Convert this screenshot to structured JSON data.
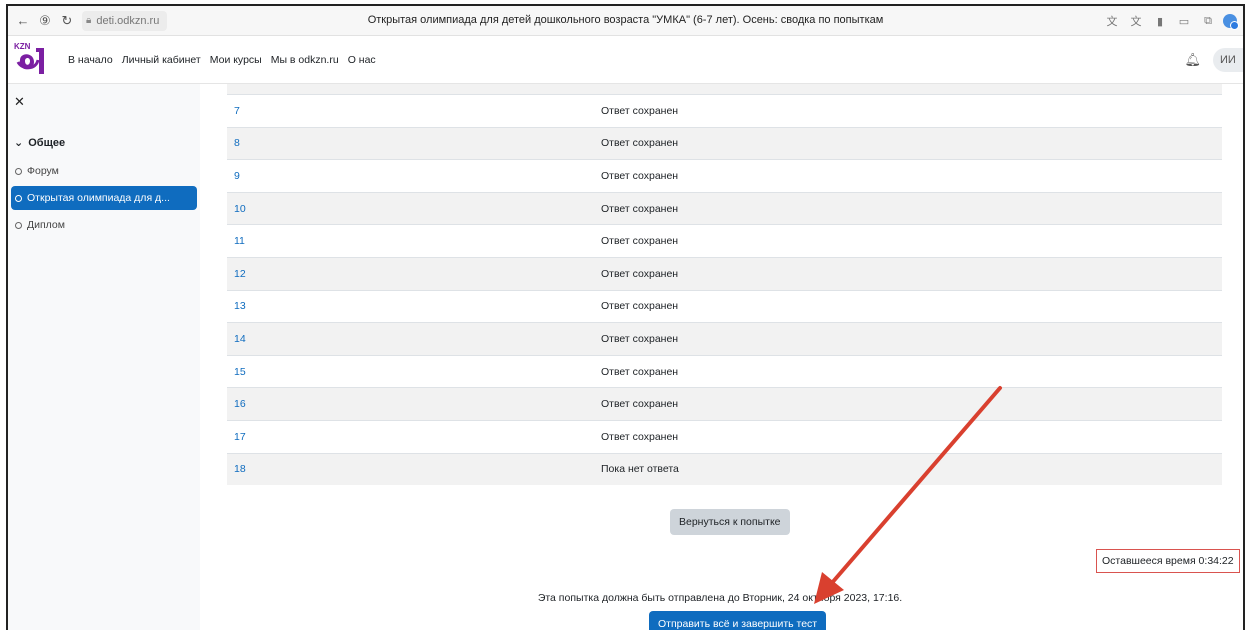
{
  "browser": {
    "url": "deti.odkzn.ru",
    "tab_title": "Открытая олимпиада для детей дошкольного возраста \"УМКА\" (6-7 лет). Осень: сводка по попыткам"
  },
  "nav": {
    "logo_text": "KZN",
    "links": [
      "В начало",
      "Личный кабинет",
      "Мои курсы",
      "Мы в odkzn.ru",
      "О нас"
    ],
    "avatar_initials": "ИИ"
  },
  "drawer": {
    "section": "Общее",
    "items": [
      {
        "label": "Форум",
        "active": false
      },
      {
        "label": "Открытая олимпиада для д...",
        "active": true
      },
      {
        "label": "Диплом",
        "active": false
      }
    ]
  },
  "summary": {
    "rows": [
      {
        "num": "7",
        "status": "Ответ сохранен"
      },
      {
        "num": "8",
        "status": "Ответ сохранен"
      },
      {
        "num": "9",
        "status": "Ответ сохранен"
      },
      {
        "num": "10",
        "status": "Ответ сохранен"
      },
      {
        "num": "11",
        "status": "Ответ сохранен"
      },
      {
        "num": "12",
        "status": "Ответ сохранен"
      },
      {
        "num": "13",
        "status": "Ответ сохранен"
      },
      {
        "num": "14",
        "status": "Ответ сохранен"
      },
      {
        "num": "15",
        "status": "Ответ сохранен"
      },
      {
        "num": "16",
        "status": "Ответ сохранен"
      },
      {
        "num": "17",
        "status": "Ответ сохранен"
      },
      {
        "num": "18",
        "status": "Пока нет ответа"
      }
    ],
    "return_button": "Вернуться к попытке",
    "timer": "Оставшееся время 0:34:22",
    "deadline": "Эта попытка должна быть отправлена до Вторник, 24 октября 2023, 17:16.",
    "submit_button": "Отправить всё и завершить тест"
  },
  "colors": {
    "accent": "#0f6cbf",
    "arrow": "#d9402f",
    "logo_purple": "#7b1fa2"
  }
}
